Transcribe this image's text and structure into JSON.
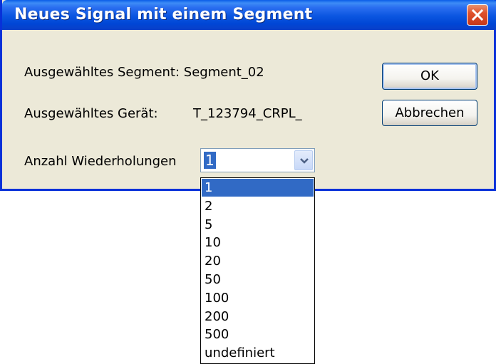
{
  "window": {
    "title": "Neues Signal mit einem Segment"
  },
  "fields": {
    "segment_label": "Ausgewähltes Segment: Segment_02",
    "device_label": "Ausgewähltes Gerät:",
    "device_value": "T_123794_CRPL_",
    "repetitions_label": "Anzahl Wiederholungen"
  },
  "buttons": {
    "ok": "OK",
    "cancel": "Abbrechen"
  },
  "repetitions": {
    "selected": "1",
    "options": [
      "1",
      "2",
      "5",
      "10",
      "20",
      "50",
      "100",
      "200",
      "500",
      "undefiniert"
    ],
    "highlighted_index": 0
  },
  "icons": {
    "close": "close-icon",
    "dropdown_arrow": "chevron-down-icon"
  },
  "colors": {
    "title_bar": "#0a55e0",
    "close_button": "#e0512c",
    "dialog_face": "#ece9d8",
    "selection": "#316ac5"
  }
}
